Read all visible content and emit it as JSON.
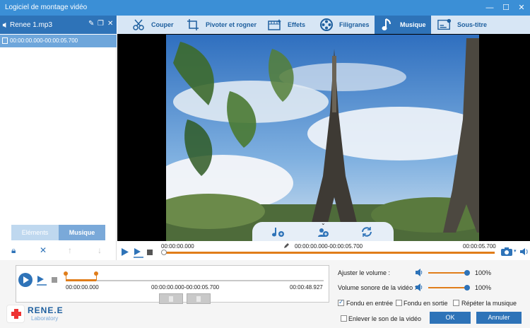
{
  "window": {
    "title": "Logiciel de montage vidéo",
    "controls": {
      "minimize": "—",
      "maximize": "☐",
      "close": "✕"
    }
  },
  "left_panel": {
    "file_name": "Renee 1.mp3",
    "segment": "00:00:00.000-00:00:05.700",
    "tabs": {
      "elements": "Eléments",
      "musique": "Musique"
    }
  },
  "toolbar": {
    "items": [
      {
        "label": "Couper",
        "icon": "cut-icon"
      },
      {
        "label": "Pivoter et rogner",
        "icon": "rotate-crop-icon"
      },
      {
        "label": "Effets",
        "icon": "effects-icon"
      },
      {
        "label": "Filigranes",
        "icon": "watermark-icon"
      },
      {
        "label": "Musique",
        "icon": "music-icon"
      },
      {
        "label": "Sous-titre",
        "icon": "subtitle-icon"
      }
    ],
    "active": "Musique"
  },
  "playback": {
    "current_time": "00:00:00.000",
    "range": "00:00:00.000-00:00:05.700",
    "end_time": "00:00:05.700"
  },
  "timeline": {
    "start": "00:00:00.000",
    "range": "00:00:00.000-00:00:05.700",
    "total": "00:00:48.927"
  },
  "audio": {
    "volume_label": "Ajuster le volume :",
    "volume_value": "100%",
    "video_volume_label": "Volume sonore de la vidéo :",
    "video_volume_value": "100%",
    "fade_in": "Fondu en entrée",
    "fade_out": "Fondu en sortie",
    "repeat": "Répéter la musique",
    "remove_video_sound": "Enlever le son de la vidéo"
  },
  "buttons": {
    "ok": "OK",
    "cancel": "Annuler"
  },
  "brand": {
    "name": "RENE.E",
    "sub": "Laboratory"
  },
  "colors": {
    "accent": "#2e73b8",
    "progress": "#e07d1a",
    "titlebar": "#3b8fd6"
  }
}
